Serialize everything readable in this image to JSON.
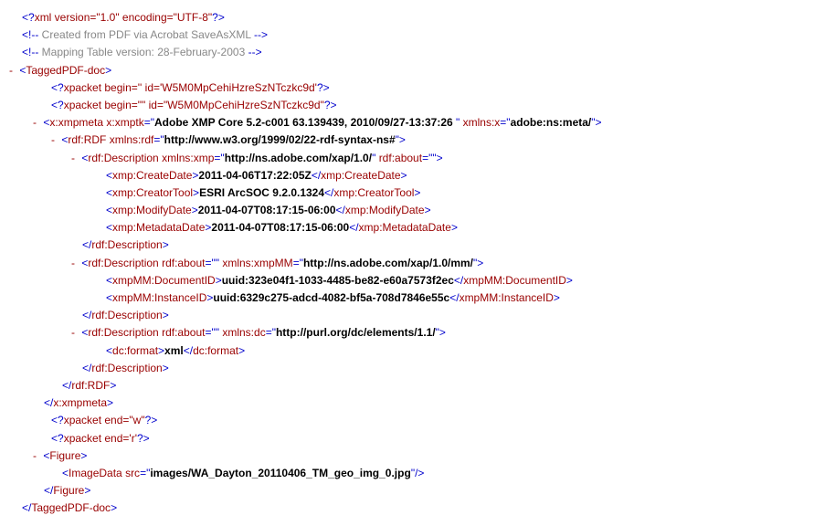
{
  "xml_decl": "xml version=\"1.0\" encoding=\"UTF-8\"",
  "comment1": " Created from PDF via Acrobat SaveAsXML ",
  "comment2": " Mapping Table version: 28-February-2003 ",
  "root_tag": "TaggedPDF-doc",
  "xpacket_begin1_full": "xpacket begin='' id='W5M0MpCehiHzreSzNTczkc9d'",
  "xpacket_begin2_full": "xpacket begin=\"\" id=\"W5M0MpCehiHzreSzNTczkc9d\"",
  "xmpmeta_tag": "x:xmpmeta",
  "xmptk_attr": "x:xmptk",
  "xmptk_val": "Adobe XMP Core 5.2-c001 63.139439, 2010/09/27-13:37:26 ",
  "xmlnsx_attr": "xmlns:x",
  "xmlnsx_val": "adobe:ns:meta/",
  "rdf_tag": "rdf:RDF",
  "xmlnsrdf_attr": "xmlns:rdf",
  "xmlnsrdf_val": "http://www.w3.org/1999/02/22-rdf-syntax-ns#",
  "desc_tag": "rdf:Description",
  "about_attr": "rdf:about",
  "about_val": "",
  "xmlnsxmp_attr": "xmlns:xmp",
  "xmlnsxmp_val": "http://ns.adobe.com/xap/1.0/",
  "createdate_tag": "xmp:CreateDate",
  "createdate_val": "2011-04-06T17:22:05Z",
  "creatortool_tag": "xmp:CreatorTool",
  "creatortool_val": "ESRI ArcSOC 9.2.0.1324",
  "modifydate_tag": "xmp:ModifyDate",
  "modifydate_val": "2011-04-07T08:17:15-06:00",
  "metadatadate_tag": "xmp:MetadataDate",
  "metadatadate_val": "2011-04-07T08:17:15-06:00",
  "xmlnsxmpmm_attr": "xmlns:xmpMM",
  "xmlnsxmpmm_val": "http://ns.adobe.com/xap/1.0/mm/",
  "documentid_tag": "xmpMM:DocumentID",
  "documentid_val": "uuid:323e04f1-1033-4485-be82-e60a7573f2ec",
  "instanceid_tag": "xmpMM:InstanceID",
  "instanceid_val": "uuid:6329c275-adcd-4082-bf5a-708d7846e55c",
  "xmlnsdc_attr": "xmlns:dc",
  "xmlnsdc_val": "http://purl.org/dc/elements/1.1/",
  "format_tag": "dc:format",
  "format_val": "xml",
  "xpacket_end1": "xpacket end=\"w\"",
  "xpacket_end2": "xpacket end='r'",
  "figure_tag": "Figure",
  "imagedata_tag": "ImageData",
  "src_attr": "src",
  "src_val": "images/WA_Dayton_20110406_TM_geo_img_0.jpg"
}
